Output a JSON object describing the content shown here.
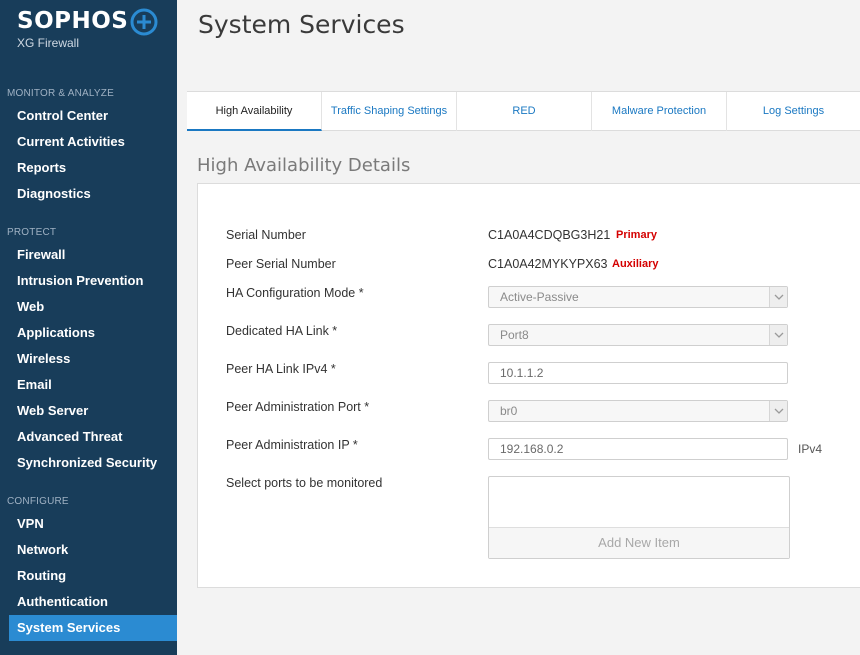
{
  "brand": {
    "name": "SOPHOS",
    "product": "XG Firewall"
  },
  "sidebar": {
    "sections": [
      {
        "title": "MONITOR & ANALYZE",
        "items": [
          {
            "label": "Control Center"
          },
          {
            "label": "Current Activities"
          },
          {
            "label": "Reports"
          },
          {
            "label": "Diagnostics"
          }
        ]
      },
      {
        "title": "PROTECT",
        "items": [
          {
            "label": "Firewall"
          },
          {
            "label": "Intrusion Prevention"
          },
          {
            "label": "Web"
          },
          {
            "label": "Applications"
          },
          {
            "label": "Wireless"
          },
          {
            "label": "Email"
          },
          {
            "label": "Web Server"
          },
          {
            "label": "Advanced Threat"
          },
          {
            "label": "Synchronized Security"
          }
        ]
      },
      {
        "title": "CONFIGURE",
        "items": [
          {
            "label": "VPN"
          },
          {
            "label": "Network"
          },
          {
            "label": "Routing"
          },
          {
            "label": "Authentication"
          },
          {
            "label": "System Services",
            "active": true
          }
        ]
      }
    ]
  },
  "page": {
    "title": "System Services"
  },
  "tabs": [
    {
      "label": "High Availability",
      "active": true
    },
    {
      "label": "Traffic Shaping Settings"
    },
    {
      "label": "RED"
    },
    {
      "label": "Malware Protection"
    },
    {
      "label": "Log Settings"
    }
  ],
  "ha": {
    "heading": "High Availability Details",
    "serial_label": "Serial Number",
    "serial_value": "C1A0A4CDQBG3H21",
    "serial_role": "Primary",
    "peer_serial_label": "Peer Serial Number",
    "peer_serial_value": "C1A0A42MYKYPX63",
    "peer_serial_role": "Auxiliary",
    "mode_label": "HA Configuration Mode *",
    "mode_value": "Active-Passive",
    "link_label": "Dedicated HA Link *",
    "link_value": "Port8",
    "peer_link_ip_label": "Peer HA Link IPv4 *",
    "peer_link_ip_value": "10.1.1.2",
    "peer_admin_port_label": "Peer Administration Port *",
    "peer_admin_port_value": "br0",
    "peer_admin_ip_label": "Peer Administration IP *",
    "peer_admin_ip_value": "192.168.0.2",
    "peer_admin_ip_suffix": "IPv4",
    "monitor_label": "Select ports to be monitored",
    "add_item_label": "Add New Item"
  },
  "colors": {
    "sidebar_bg": "#183d5a",
    "active_nav": "#2b8bd2",
    "link_blue": "#1a78c2",
    "role_red": "#d40000"
  }
}
